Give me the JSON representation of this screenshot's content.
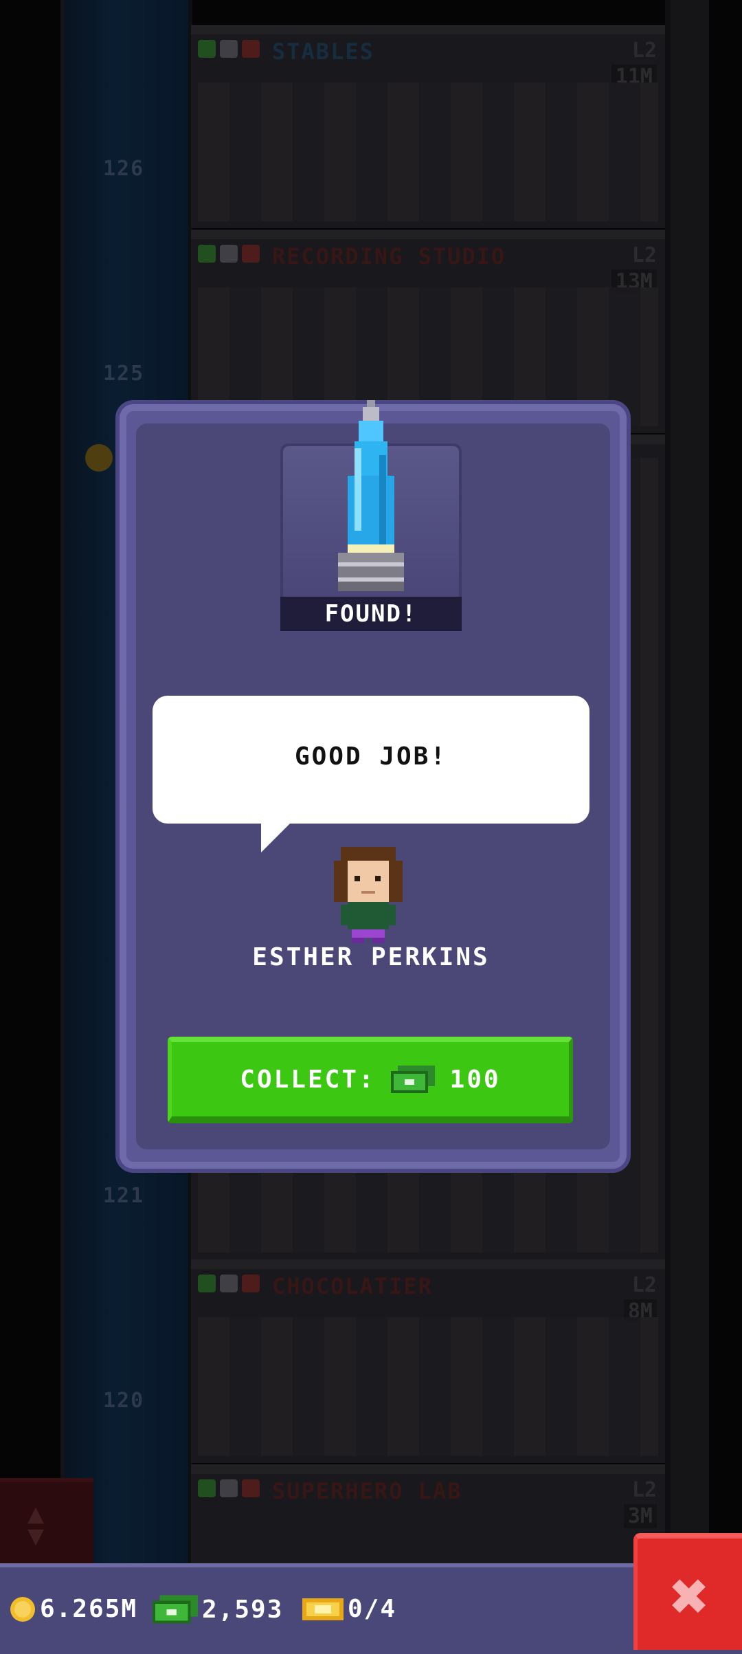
{
  "tower": {
    "floor_numbers": [
      "126",
      "125",
      "121",
      "120"
    ],
    "floors": [
      {
        "name": "STABLES",
        "level": "L2",
        "value": "11M",
        "color": "#1e3c56"
      },
      {
        "name": "RECORDING STUDIO",
        "level": "L2",
        "value": "13M",
        "color": "#4a1e1e"
      },
      {
        "name": "CHOCOLATIER",
        "level": "L2",
        "value": "8M",
        "color": "#4a1e1e"
      },
      {
        "name": "SUPERHERO LAB",
        "level": "L2",
        "value": "3M",
        "color": "#4a1e1e"
      }
    ]
  },
  "modal": {
    "found_label": "FOUND!",
    "speech": "GOOD JOB!",
    "character_name": "ESTHER PERKINS",
    "collect_label": "COLLECT:",
    "collect_amount": "100",
    "collect_icon": "cash-icon"
  },
  "status_bar": {
    "coins": "6.265M",
    "cash": "2,593",
    "tickets": "0/4",
    "coin_icon": "coin-icon",
    "cash_icon": "cash-icon",
    "ticket_icon": "ticket-icon",
    "close_icon": "close-icon",
    "close_symbol": "✖"
  },
  "colors": {
    "modal_bg": "#4b4878",
    "collect_green": "#3bc712",
    "close_red": "#e02a2a"
  }
}
